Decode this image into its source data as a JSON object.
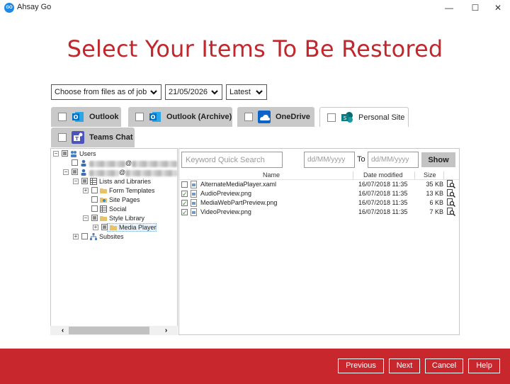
{
  "window": {
    "app_icon_text": "GO",
    "title": "Ahsay Go",
    "minimize_glyph": "—",
    "maximize_glyph": "☐",
    "close_glyph": "✕"
  },
  "page": {
    "headline": "Select Your Items To Be Restored"
  },
  "filters": {
    "choose_from": "Choose from files as of job",
    "date": "21/05/2026",
    "version": "Latest"
  },
  "tabs": [
    {
      "label": "Outlook",
      "icon": "outlook-icon",
      "color": "#0072c6",
      "active": false
    },
    {
      "label": "Outlook (Archive)",
      "icon": "outlook-archive-icon",
      "color": "#0072c6",
      "active": false
    },
    {
      "label": "OneDrive",
      "icon": "onedrive-icon",
      "color": "#0a64c8",
      "active": false
    },
    {
      "label": "Personal Site",
      "icon": "sharepoint-icon",
      "color": "#0b7d86",
      "active": true
    },
    {
      "label": "Teams Chat",
      "icon": "teams-icon",
      "color": "#4b53bc",
      "active": false
    }
  ],
  "tree": {
    "users": "Users",
    "user1_suffix": "@",
    "user2_suffix": "@",
    "lists_and_libraries": "Lists and Libraries",
    "form_templates": "Form Templates",
    "site_pages": "Site Pages",
    "social": "Social",
    "style_library": "Style Library",
    "media_player": "Media Player",
    "subsites": "Subsites"
  },
  "search": {
    "keyword_placeholder": "Keyword Quick Search",
    "from_placeholder": "dd/MM/yyyy",
    "to_label": "To",
    "to_placeholder": "dd/MM/yyyy",
    "show_label": "Show"
  },
  "file_list": {
    "columns": {
      "name": "Name",
      "date": "Date modified",
      "size": "Size"
    },
    "rows": [
      {
        "name": "AlternateMediaPlayer.xaml",
        "date": "16/07/2018 11:35",
        "size": "35 KB",
        "checked": false
      },
      {
        "name": "AudioPreview.png",
        "date": "16/07/2018 11:35",
        "size": "13 KB",
        "checked": true
      },
      {
        "name": "MediaWebPartPreview.png",
        "date": "16/07/2018 11:35",
        "size": "6 KB",
        "checked": true
      },
      {
        "name": "VideoPreview.png",
        "date": "16/07/2018 11:35",
        "size": "7 KB",
        "checked": true
      }
    ]
  },
  "scroll": {
    "left_arrow": "‹",
    "right_arrow": "›"
  },
  "footer": {
    "previous": "Previous",
    "next": "Next",
    "cancel": "Cancel",
    "help": "Help"
  },
  "colors": {
    "brand_red": "#c1272d",
    "footer_red": "#c8272e",
    "tab_gray": "#c9c9c9"
  }
}
